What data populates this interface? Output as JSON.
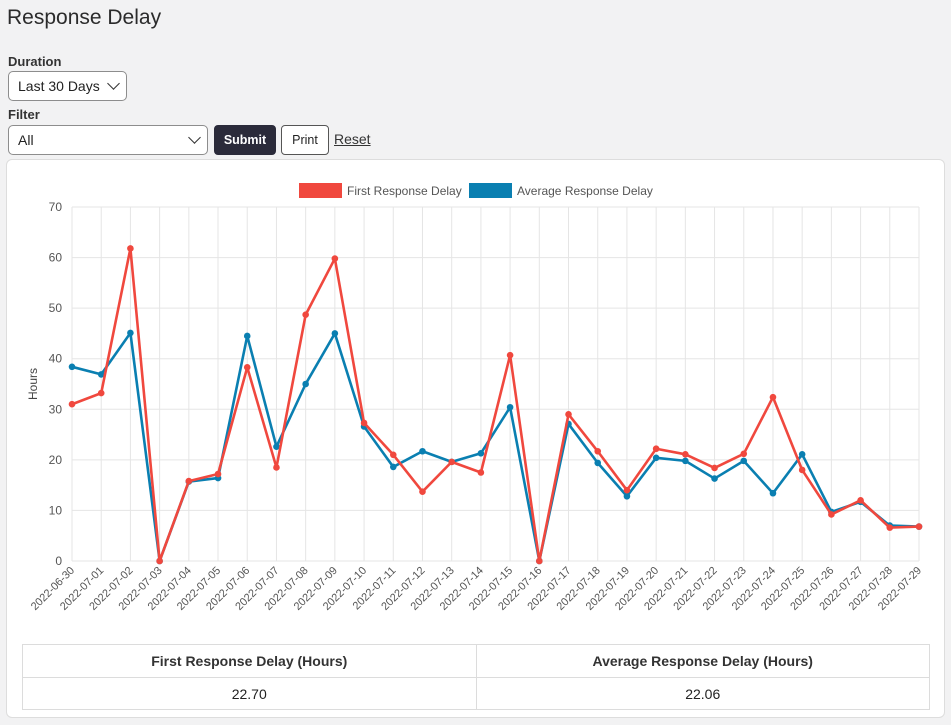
{
  "page": {
    "title": "Response Delay"
  },
  "controls": {
    "duration_label": "Duration",
    "duration_value": "Last 30 Days",
    "filter_label": "Filter",
    "filter_value": "All",
    "submit_label": "Submit",
    "print_label": "Print",
    "reset_label": "Reset"
  },
  "colors": {
    "first": "#f0483e",
    "average": "#0a7fb1"
  },
  "chart_data": {
    "type": "line",
    "ylabel": "Hours",
    "xlabel": "",
    "ylim": [
      0,
      70
    ],
    "yticks": [
      0,
      10,
      20,
      30,
      40,
      50,
      60,
      70
    ],
    "grid": true,
    "legend_position": "top",
    "categories": [
      "2022-06-30",
      "2022-07-01",
      "2022-07-02",
      "2022-07-03",
      "2022-07-04",
      "2022-07-05",
      "2022-07-06",
      "2022-07-07",
      "2022-07-08",
      "2022-07-09",
      "2022-07-10",
      "2022-07-11",
      "2022-07-12",
      "2022-07-13",
      "2022-07-14",
      "2022-07-15",
      "2022-07-16",
      "2022-07-17",
      "2022-07-18",
      "2022-07-19",
      "2022-07-20",
      "2022-07-21",
      "2022-07-22",
      "2022-07-23",
      "2022-07-24",
      "2022-07-25",
      "2022-07-26",
      "2022-07-27",
      "2022-07-28",
      "2022-07-29"
    ],
    "series": [
      {
        "name": "First Response Delay",
        "values": [
          31.0,
          33.2,
          61.8,
          0,
          15.8,
          17.2,
          38.3,
          18.5,
          48.7,
          59.8,
          27.3,
          21.0,
          13.7,
          19.6,
          17.5,
          40.7,
          0,
          29.0,
          21.7,
          14.0,
          22.2,
          21.1,
          18.4,
          21.2,
          32.4,
          18.0,
          9.2,
          12.0,
          6.6,
          6.8
        ]
      },
      {
        "name": "Average Response Delay",
        "values": [
          38.4,
          36.9,
          45.1,
          0,
          15.7,
          16.4,
          44.5,
          22.6,
          35.0,
          45.0,
          26.6,
          18.6,
          21.7,
          19.6,
          21.3,
          30.4,
          0,
          27.1,
          19.4,
          12.8,
          20.4,
          19.8,
          16.3,
          19.8,
          13.4,
          21.1,
          9.7,
          11.7,
          7.0,
          6.8
        ]
      }
    ]
  },
  "summary": {
    "headers": [
      "First Response Delay (Hours)",
      "Average Response Delay (Hours)"
    ],
    "values": [
      "22.70",
      "22.06"
    ]
  }
}
